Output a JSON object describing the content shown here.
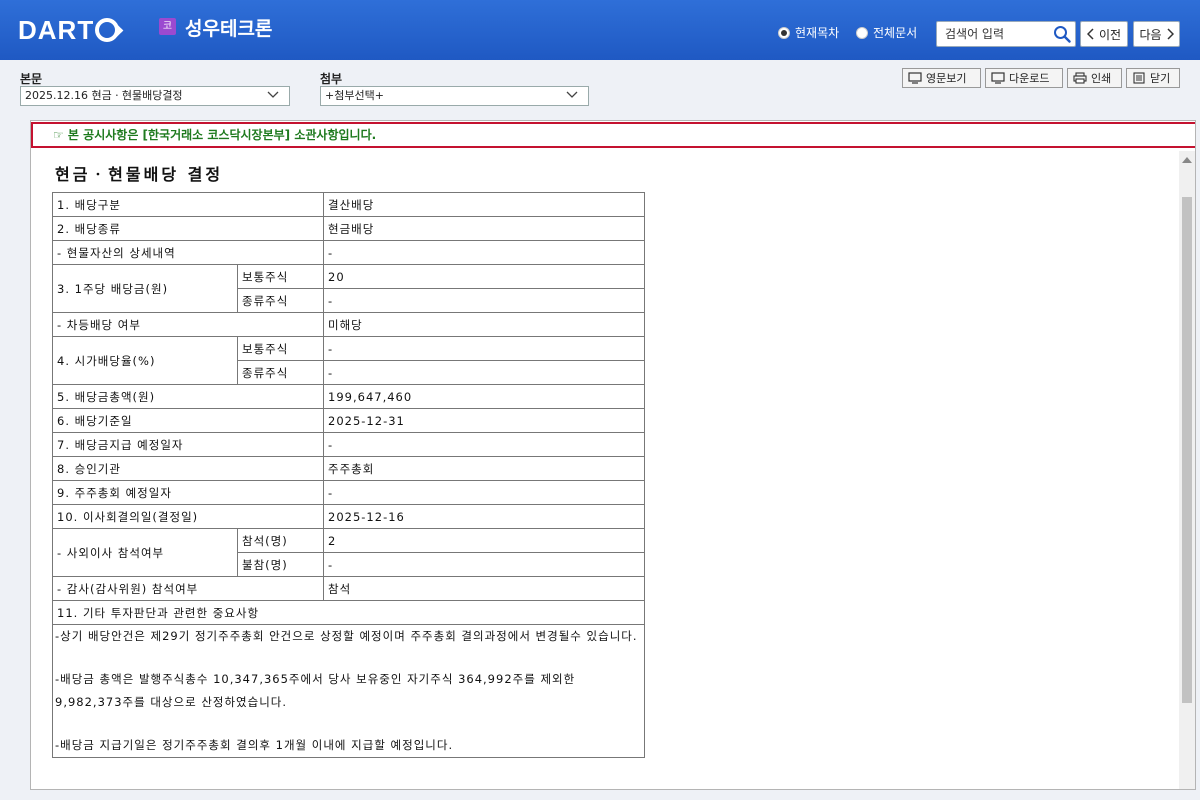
{
  "header": {
    "logo_text": "DART",
    "market_badge": "코",
    "company_name": "성우테크론",
    "radio_current": "현재목차",
    "radio_all": "전체문서",
    "search_placeholder": "검색어 입력",
    "prev_label": "이전",
    "next_label": "다음",
    "colors": {
      "bar": "#1f59c3",
      "badge": "#9b4ad0"
    }
  },
  "toolbar": {
    "main_label": "본문",
    "main_select": "2025.12.16  현금ㆍ현물배당결정",
    "attach_label": "첨부",
    "attach_select": "+첨부선택+",
    "buttons": {
      "english": "영문보기",
      "download": "다운로드",
      "print": "인쇄",
      "close": "닫기"
    }
  },
  "document": {
    "notice": "☞ 본 공시사항은 [한국거래소 코스닥시장본부] 소관사항입니다.",
    "title": "현금ㆍ현물배당 결정",
    "rows": {
      "r1": {
        "label": "1. 배당구분",
        "value": "결산배당"
      },
      "r2": {
        "label": "2. 배당종류",
        "value": "현금배당"
      },
      "r3": {
        "label": "- 현물자산의 상세내역",
        "value": "-"
      },
      "r4": {
        "label": "3. 1주당 배당금(원)",
        "sub1": "보통주식",
        "val1": "20",
        "sub2": "종류주식",
        "val2": "-"
      },
      "r5": {
        "label": "- 차등배당 여부",
        "value": "미해당"
      },
      "r6": {
        "label": "4. 시가배당율(%)",
        "sub1": "보통주식",
        "val1": "-",
        "sub2": "종류주식",
        "val2": "-"
      },
      "r7": {
        "label": "5. 배당금총액(원)",
        "value": "199,647,460"
      },
      "r8": {
        "label": "6. 배당기준일",
        "value": "2025-12-31"
      },
      "r9": {
        "label": "7. 배당금지급 예정일자",
        "value": "-"
      },
      "r10": {
        "label": "8. 승인기관",
        "value": "주주총회"
      },
      "r11": {
        "label": "9. 주주총회 예정일자",
        "value": "-"
      },
      "r12": {
        "label": "10. 이사회결의일(결정일)",
        "value": "2025-12-16"
      },
      "r13": {
        "label": "- 사외이사 참석여부",
        "sub1": "참석(명)",
        "val1": "2",
        "sub2": "불참(명)",
        "val2": "-"
      },
      "r14": {
        "label": "- 감사(감사위원) 참석여부",
        "value": "참석"
      },
      "r15": {
        "label": "11. 기타 투자판단과 관련한 중요사항"
      }
    },
    "paragraphs": {
      "p1": "-상기 배당안건은 제29기 정기주주총회 안건으로 상정할 예정이며 주주총회 결의과정에서 변경될수 있습니다.",
      "p2": "-배당금 총액은 발행주식총수 10,347,365주에서 당사 보유중인 자기주식 364,992주를 제외한 9,982,373주를 대상으로 산정하였습니다.",
      "p3": "-배당금 지급기일은 정기주주총회 결의후 1개월 이내에 지급할 예정입니다."
    }
  }
}
